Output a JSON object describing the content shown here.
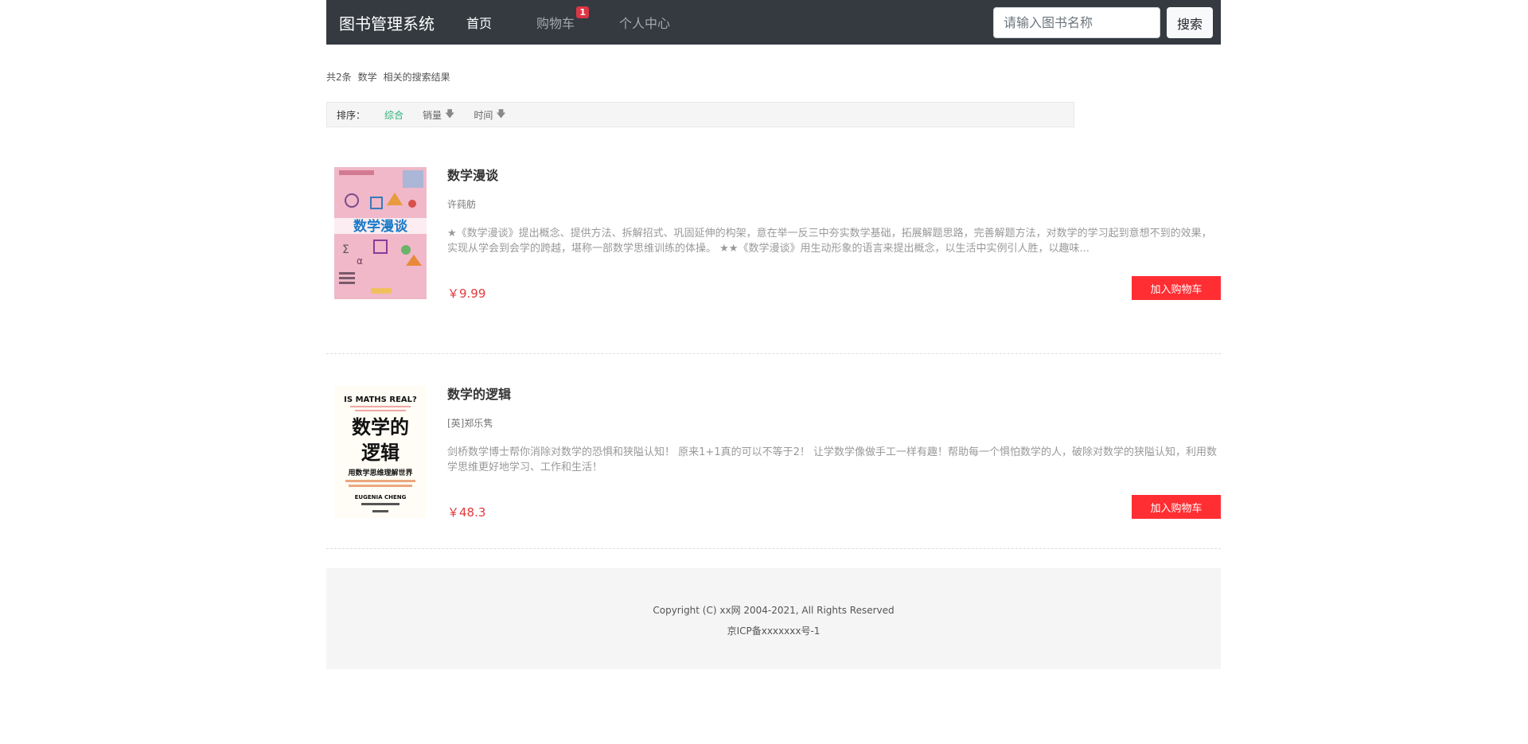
{
  "navbar": {
    "brand": "图书管理系统",
    "links": [
      {
        "label": "首页"
      },
      {
        "label": "购物车",
        "badge": "1"
      },
      {
        "label": "个人中心"
      }
    ],
    "search_placeholder": "请输入图书名称",
    "search_button": "搜索"
  },
  "summary": {
    "count": "共2条",
    "keyword": "数学",
    "suffix": "相关的搜索结果"
  },
  "sort": {
    "label": "排序：",
    "items": [
      {
        "label": "综合",
        "active": true
      },
      {
        "label": "销量",
        "arrow": "🡇"
      },
      {
        "label": "时间",
        "arrow": "🡇"
      }
    ]
  },
  "books": [
    {
      "title": "数学漫谈",
      "author": "许莼舫",
      "description": "★《数学漫谈》提出概念、提供方法、拆解招式、巩固延伸的构架，意在举一反三中夯实数学基础，拓展解题思路，完善解题方法，对数学的学习起到意想不到的效果，实现从学会到会学的跨越，堪称一部数学思维训练的体操。 ★★《数学漫谈》用生动形象的语言来提出概念，以生活中实例引人胜，以趣味...",
      "price": "￥9.99",
      "button": "加入购物车",
      "cover": {
        "title_text": "数学漫谈",
        "bg": "#f0b8c8"
      }
    },
    {
      "title": "数学的逻辑",
      "author": "[英]郑乐隽",
      "description": "剑桥数学博士帮你消除对数学的恐惧和狭隘认知！ 原来1+1真的可以不等于2！ 让学数学像做手工一样有趣！帮助每一个惧怕数学的人，破除对数学的狭隘认知，利用数学思维更好地学习、工作和生活！",
      "price": "￥48.3",
      "button": "加入购物车",
      "cover": {
        "top_text": "IS MATHS REAL?",
        "title_line1": "数学的",
        "title_line2": "逻辑",
        "subtitle": "用数学思维理解世界",
        "author": "EUGENIA CHENG",
        "bg": "#fffdf5"
      }
    }
  ],
  "footer": {
    "copyright": "Copyright (C) xx网 2004-2021, All Rights Reserved",
    "icp": "京ICP备xxxxxxx号-1"
  }
}
